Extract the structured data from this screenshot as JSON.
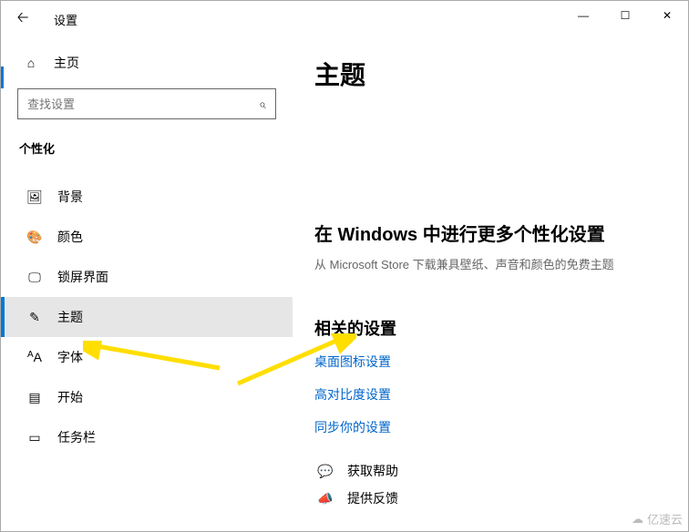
{
  "window": {
    "title": "设置",
    "minimize": "—",
    "maximize": "☐",
    "close": "✕"
  },
  "sidebar": {
    "home_label": "主页",
    "search_placeholder": "查找设置",
    "section_title": "个性化",
    "items": [
      {
        "label": "背景"
      },
      {
        "label": "颜色"
      },
      {
        "label": "锁屏界面"
      },
      {
        "label": "主题"
      },
      {
        "label": "字体"
      },
      {
        "label": "开始"
      },
      {
        "label": "任务栏"
      }
    ]
  },
  "main": {
    "page_title": "主题",
    "more_heading": "在 Windows 中进行更多个性化设置",
    "more_sub": "从 Microsoft Store 下载兼具壁纸、声音和颜色的免费主题",
    "related_heading": "相关的设置",
    "links": {
      "desktop_icons": "桌面图标设置",
      "high_contrast": "高对比度设置",
      "sync": "同步你的设置"
    },
    "help": "获取帮助",
    "feedback": "提供反馈"
  },
  "watermark": "亿速云"
}
